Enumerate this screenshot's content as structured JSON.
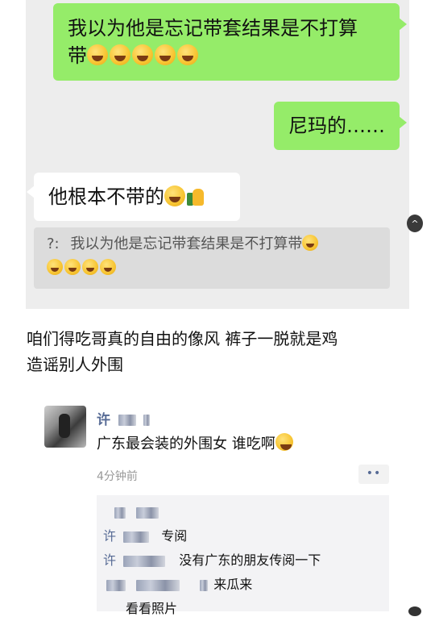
{
  "chat": {
    "msg1": {
      "text_line1": "我以为他是忘记带套结果是不打算",
      "text_line2": "带",
      "emoji_count": 5,
      "emoji": "laugh-cry-icon"
    },
    "msg2": {
      "text": "尼玛的……"
    },
    "msg3": {
      "text": "他根本不带的",
      "emoji": "laugh-cry-icon",
      "emoji2": "thumbs-up-icon"
    },
    "quote": {
      "prefix": "?:",
      "text": "我以为他是忘记带套结果是不打算带",
      "emoji_count": 5
    }
  },
  "caption": {
    "line1": "咱们得吃哥真的自由的像风 裤子一脱就是鸡",
    "line2": "造谣别人外围"
  },
  "moment": {
    "nickname": "许",
    "post_text": "广东最会装的外围女 谁吃啊",
    "time": "4分钟前",
    "more_label": "••",
    "comments": [
      {
        "name": "许",
        "text": "专阅"
      },
      {
        "name": "许",
        "text": "没有广东的朋友传阅一下"
      },
      {
        "name": "",
        "text": "来瓜来"
      },
      {
        "name": "",
        "text": "看看照片"
      }
    ]
  },
  "colors": {
    "green_bubble": "#95ec69",
    "chat_bg": "#ededed",
    "link_blue": "#576b95"
  }
}
